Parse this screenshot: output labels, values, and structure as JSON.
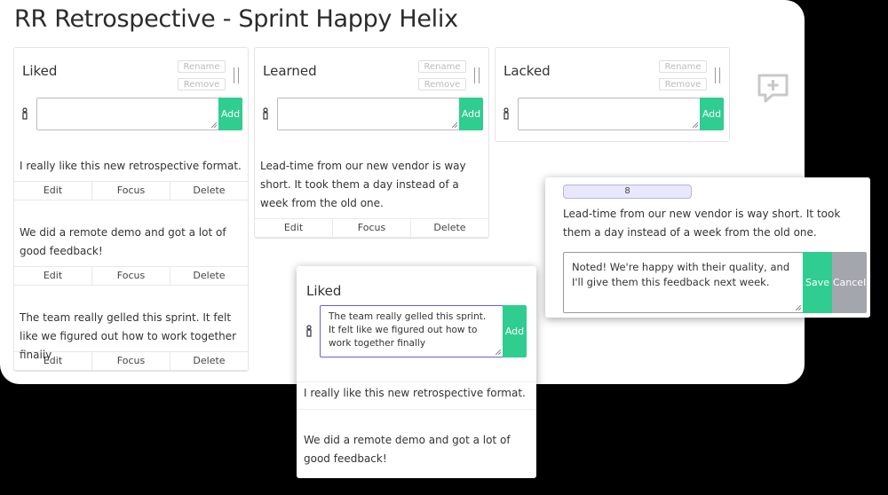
{
  "board": {
    "title": "RR Retrospective - Sprint Happy Helix"
  },
  "columns": [
    {
      "title": "Liked",
      "rename_label": "Rename",
      "remove_label": "Remove",
      "add_label": "Add",
      "cards": [
        {
          "text": "I really like this new retrospective format."
        },
        {
          "text": "We did a remote demo and got a lot of good feedback!"
        },
        {
          "text": "The team really gelled this sprint. It felt like we figured out how to work together finally"
        }
      ]
    },
    {
      "title": "Learned",
      "rename_label": "Rename",
      "remove_label": "Remove",
      "add_label": "Add",
      "cards": [
        {
          "text": "Lead-time from our new vendor is way short. It took them a day instead of a week from the old one."
        }
      ]
    },
    {
      "title": "Lacked",
      "rename_label": "Rename",
      "remove_label": "Remove",
      "add_label": "Add",
      "cards": []
    }
  ],
  "card_actions": {
    "edit": "Edit",
    "focus": "Focus",
    "delete": "Delete"
  },
  "add_column_icon": "add-comment-icon",
  "focus_popup": {
    "vote_count": "8",
    "card_text": "Lead-time from our new vendor is way short. It took them a day instead of a week from the old one.",
    "reply_value": "Noted! We're happy with their quality, and I'll give them this feedback next week.",
    "save_label": "Save",
    "cancel_label": "Cancel"
  },
  "edit_popup": {
    "title": "Liked",
    "input_value": "The team really gelled this sprint. It felt like we figured out how to work together finally",
    "add_label": "Add",
    "cards": [
      {
        "text": "I really like this new retrospective format."
      },
      {
        "text": "We did a remote demo and got a lot of good feedback!"
      }
    ]
  },
  "colors": {
    "accent_green": "#2fcd8f",
    "cancel_gray": "#a3a6ad",
    "badge_purple": "#e9e7fb",
    "focus_border": "#6a5fd8"
  }
}
